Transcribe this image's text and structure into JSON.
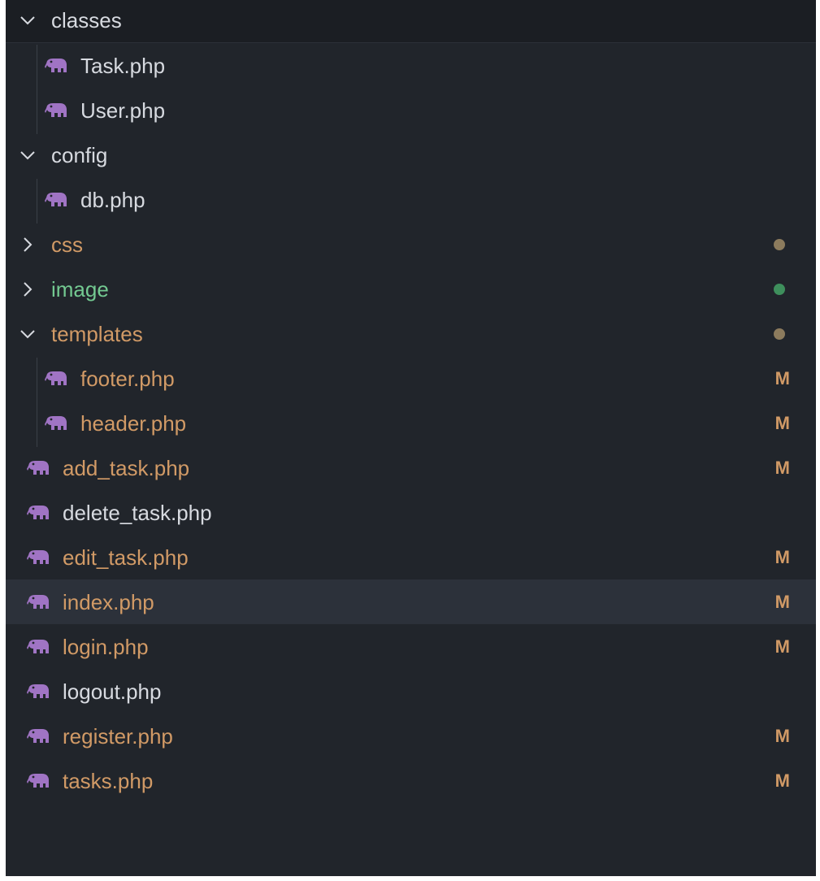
{
  "colors": {
    "modified": "#d19a66",
    "untracked": "#73c991",
    "default_text": "#d7dae0",
    "folder_dot": "#8c7b5d",
    "untracked_dot": "#3e8f5c",
    "php_icon": "#a074c4"
  },
  "icons": {
    "expanded": "chevron-down-icon",
    "collapsed": "chevron-right-icon",
    "file": "php-elephant-icon"
  },
  "tree": [
    {
      "label": "classes",
      "type": "folder",
      "expanded": true,
      "status": "",
      "indent": 0
    },
    {
      "label": "Task.php",
      "type": "file",
      "status": "",
      "indent": 1
    },
    {
      "label": "User.php",
      "type": "file",
      "status": "",
      "indent": 1
    },
    {
      "label": "config",
      "type": "folder",
      "expanded": true,
      "status": "",
      "indent": 0
    },
    {
      "label": "db.php",
      "type": "file",
      "status": "",
      "indent": 1
    },
    {
      "label": "css",
      "type": "folder",
      "expanded": false,
      "status": "dot-modified",
      "indent": 0
    },
    {
      "label": "image",
      "type": "folder",
      "expanded": false,
      "status": "dot-untracked",
      "indent": 0
    },
    {
      "label": "templates",
      "type": "folder",
      "expanded": true,
      "status": "dot-modified",
      "indent": 0
    },
    {
      "label": "footer.php",
      "type": "file",
      "status": "M",
      "indent": 1
    },
    {
      "label": "header.php",
      "type": "file",
      "status": "M",
      "indent": 1
    },
    {
      "label": "add_task.php",
      "type": "file",
      "status": "M",
      "indent": 0
    },
    {
      "label": "delete_task.php",
      "type": "file",
      "status": "",
      "indent": 0
    },
    {
      "label": "edit_task.php",
      "type": "file",
      "status": "M",
      "indent": 0
    },
    {
      "label": "index.php",
      "type": "file",
      "status": "M",
      "indent": 0,
      "selected": true
    },
    {
      "label": "login.php",
      "type": "file",
      "status": "M",
      "indent": 0
    },
    {
      "label": "logout.php",
      "type": "file",
      "status": "",
      "indent": 0
    },
    {
      "label": "register.php",
      "type": "file",
      "status": "M",
      "indent": 0
    },
    {
      "label": "tasks.php",
      "type": "file",
      "status": "M",
      "indent": 0
    }
  ]
}
